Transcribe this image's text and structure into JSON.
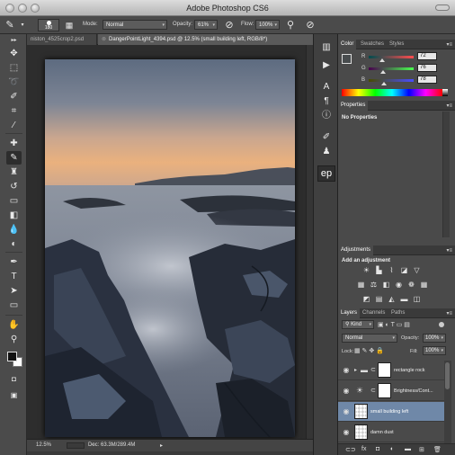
{
  "window": {
    "title": "Adobe Photoshop CS6"
  },
  "options_bar": {
    "brush_size": "180",
    "mode_label": "Mode:",
    "mode_value": "Normal",
    "opacity_label": "Opacity:",
    "opacity_value": "61%",
    "flow_label": "Flow:",
    "flow_value": "100%"
  },
  "documents": {
    "tabs": [
      {
        "label": "niston_4525crop2.psd"
      },
      {
        "label": "DangerPointLight_4394.psd @ 12.5% (small building left, RGB/8*)"
      }
    ]
  },
  "status": {
    "zoom": "12.5%",
    "doc_size": "Doc: 63.3M/289.4M"
  },
  "color_panel": {
    "tabs": [
      "Color",
      "Swatches",
      "Styles"
    ],
    "r_label": "R",
    "g_label": "G",
    "b_label": "B",
    "r": "72",
    "g": "76",
    "b": "78"
  },
  "properties_panel": {
    "tab": "Properties",
    "message": "No Properties"
  },
  "adjustments_panel": {
    "tab": "Adjustments",
    "heading": "Add an adjustment"
  },
  "layers_panel": {
    "tabs": [
      "Layers",
      "Channels",
      "Paths"
    ],
    "filter_kind": "Kind",
    "blend_mode": "Normal",
    "opacity_label": "Opacity:",
    "opacity_value": "100%",
    "lock_label": "Lock:",
    "fill_label": "Fill:",
    "fill_value": "100%",
    "layers": [
      {
        "name": "rectangle rock",
        "type": "group"
      },
      {
        "name": "Brightness/Cont...",
        "type": "adjustment"
      },
      {
        "name": "small building left",
        "type": "pixel",
        "selected": true
      },
      {
        "name": "damn dust",
        "type": "pixel"
      }
    ]
  },
  "dock": {
    "ep_label": "ep"
  },
  "colors": {
    "ui_dark": "#3a3a3a",
    "selection": "#6f88a8",
    "sky_glow": "#e9b07c"
  }
}
